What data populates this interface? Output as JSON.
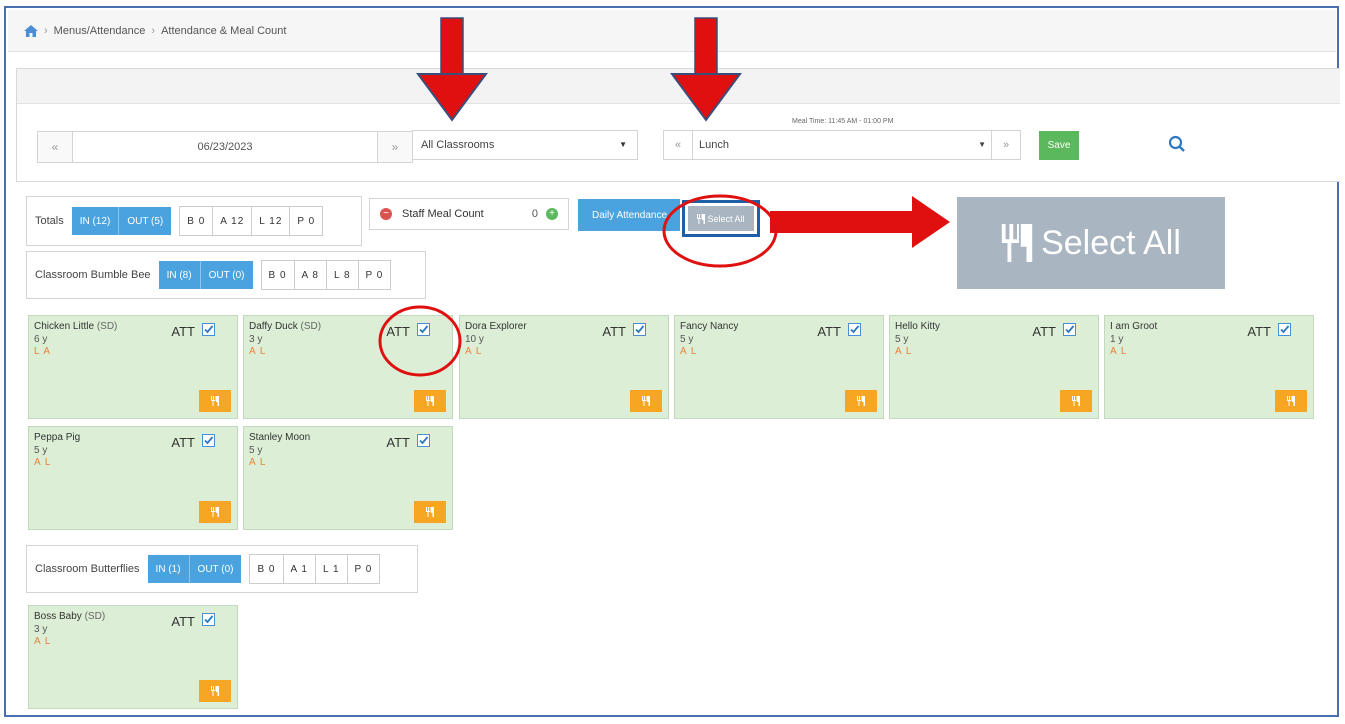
{
  "breadcrumb": {
    "items": [
      "Menus/Attendance",
      "Attendance & Meal Count"
    ]
  },
  "filters": {
    "date": "06/23/2023",
    "prev_label": "«",
    "next_label": "»",
    "classroom": "All Classrooms",
    "meal_time": "Meal Time: 11:45 AM - 01:00 PM",
    "meal": "Lunch",
    "save_label": "Save"
  },
  "totals": {
    "label": "Totals",
    "in": "IN (12)",
    "out": "OUT (5)",
    "counts": [
      "B 0",
      "A 12",
      "L 12",
      "P 0"
    ]
  },
  "staff_meal": {
    "label": "Staff Meal Count",
    "value": "0"
  },
  "daily_attendance_label": "Daily Attendance",
  "select_all_label": "Select All",
  "classrooms": [
    {
      "label": "Classroom Bumble Bee",
      "in": "IN (8)",
      "out": "OUT (0)",
      "counts": [
        "B 0",
        "A 8",
        "L 8",
        "P 0"
      ],
      "children": [
        {
          "name": "Chicken Little",
          "tag": "(SD)",
          "age": "6 y",
          "meals": "L A",
          "att": "ATT"
        },
        {
          "name": "Daffy Duck",
          "tag": "(SD)",
          "age": "3 y",
          "meals": "A L",
          "att": "ATT"
        },
        {
          "name": "Dora Explorer",
          "tag": "",
          "age": "10 y",
          "meals": "A L",
          "att": "ATT"
        },
        {
          "name": "Fancy Nancy",
          "tag": "",
          "age": "5 y",
          "meals": "A L",
          "att": "ATT"
        },
        {
          "name": "Hello Kitty",
          "tag": "",
          "age": "5 y",
          "meals": "A L",
          "att": "ATT"
        },
        {
          "name": "I am Groot",
          "tag": "",
          "age": "1 y",
          "meals": "A L",
          "att": "ATT"
        },
        {
          "name": "Peppa Pig",
          "tag": "",
          "age": "5 y",
          "meals": "A L",
          "att": "ATT"
        },
        {
          "name": "Stanley Moon",
          "tag": "",
          "age": "5 y",
          "meals": "A L",
          "att": "ATT"
        }
      ]
    },
    {
      "label": "Classroom Butterflies",
      "in": "IN (1)",
      "out": "OUT (0)",
      "counts": [
        "B 0",
        "A 1",
        "L 1",
        "P 0"
      ],
      "children": [
        {
          "name": "Boss Baby",
          "tag": "(SD)",
          "age": "3 y",
          "meals": "A L",
          "att": "ATT"
        }
      ]
    }
  ],
  "colors": {
    "accent": "#4aa3df",
    "save": "#5cb85c",
    "card": "#dcefd6",
    "meal_button": "#f6a623",
    "annotation": "#e01010"
  },
  "icons": [
    "home-icon",
    "search-icon",
    "minus-circle-icon",
    "plus-circle-icon",
    "utensils-icon",
    "checkbox-icon"
  ]
}
